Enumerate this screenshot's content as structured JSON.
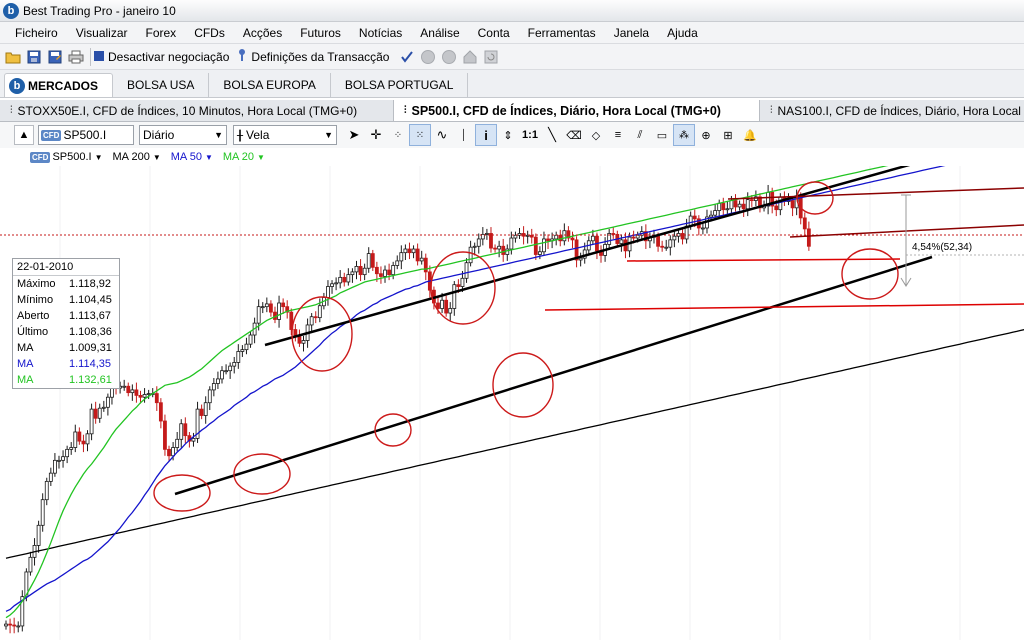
{
  "window": {
    "title": "Best Trading Pro - janeiro 10",
    "app_icon": "b"
  },
  "menu": [
    "Ficheiro",
    "Visualizar",
    "Forex",
    "CFDs",
    "Acções",
    "Futuros",
    "Notícias",
    "Análise",
    "Conta",
    "Ferramentas",
    "Janela",
    "Ajuda"
  ],
  "toolbar": {
    "deactivate_label": "Desactivar negociação",
    "definitions_label": "Definições da Transacção"
  },
  "market_tabs": {
    "brand": "MERCADOS",
    "items": [
      "BOLSA USA",
      "BOLSA EUROPA",
      "BOLSA PORTUGAL"
    ]
  },
  "chart_tabs": [
    {
      "label": "STOXX50E.I, CFD de Índices, 10 Minutos, Hora Local (TMG+0)",
      "active": false
    },
    {
      "label": "SP500.I, CFD de Índices, Diário, Hora Local (TMG+0)",
      "active": true
    },
    {
      "label": "NAS100.I, CFD de Índices, Diário, Hora Local (TMG+0)",
      "active": false
    }
  ],
  "chart_toolbar": {
    "symbol": "SP500.I",
    "symbol_badge": "CFD",
    "timeframe": "Diário",
    "chart_type": "Vela",
    "ratio_label": "1:1"
  },
  "legend": {
    "symbol": "SP500.I",
    "ma200": "MA 200",
    "ma50": "MA 50",
    "ma20": "MA 20",
    "colors": {
      "ma200": "#000000",
      "ma50": "#1414cc",
      "ma20": "#22c422"
    }
  },
  "info": {
    "date": "22-01-2010",
    "rows": [
      {
        "label": "Máximo",
        "value": "1.118,92",
        "color": "#000000"
      },
      {
        "label": "Mínimo",
        "value": "1.104,45",
        "color": "#000000"
      },
      {
        "label": "Aberto",
        "value": "1.113,67",
        "color": "#000000"
      },
      {
        "label": "Último",
        "value": "1.108,36",
        "color": "#000000"
      },
      {
        "label": "MA",
        "value": "1.009,31",
        "color": "#000000"
      },
      {
        "label": "MA",
        "value": "1.114,35",
        "color": "#1414cc"
      },
      {
        "label": "MA",
        "value": "1.132,61",
        "color": "#22c422"
      }
    ]
  },
  "annotation": {
    "measure_label": "4,54%(52,34)"
  },
  "chart_data": {
    "type": "candlestick",
    "x": [
      0,
      1,
      2,
      3,
      4,
      5,
      6,
      7,
      8,
      9,
      10,
      11,
      12,
      13,
      14,
      15,
      16,
      17,
      18,
      19,
      20,
      21,
      22,
      23,
      24,
      25,
      26,
      27,
      28,
      29,
      30,
      31,
      32,
      33,
      34,
      35,
      36,
      37,
      38,
      39,
      40,
      41,
      42,
      43,
      44,
      45,
      46,
      47,
      48,
      49,
      50,
      51,
      52,
      53,
      54,
      55,
      56,
      57,
      58,
      59,
      60,
      61,
      62,
      63,
      64,
      65,
      66,
      67,
      68,
      69,
      70,
      71,
      72,
      73,
      74,
      75,
      76,
      77,
      78,
      79,
      80,
      81,
      82,
      83,
      84,
      85,
      86,
      87,
      88,
      89,
      90,
      91,
      92,
      93,
      94,
      95,
      96,
      97,
      98,
      99,
      100,
      101,
      102,
      103,
      104,
      105,
      106,
      107,
      108,
      109,
      110,
      111,
      112,
      113,
      114,
      115,
      116,
      117,
      118,
      119,
      120,
      121,
      122,
      123,
      124,
      125,
      126,
      127,
      128,
      129,
      130,
      131,
      132,
      133,
      134,
      135,
      136,
      137,
      138,
      139,
      140,
      141,
      142,
      143,
      144,
      145,
      146,
      147,
      148,
      149,
      150,
      151,
      152,
      153,
      154,
      155,
      156,
      157,
      158,
      159,
      160,
      161,
      162,
      163,
      164,
      165,
      166,
      167,
      168,
      169,
      170,
      171,
      172,
      173,
      174,
      175,
      176,
      177,
      178,
      179,
      180,
      181,
      182,
      183,
      184,
      185,
      186,
      187,
      188,
      189,
      190,
      191,
      192,
      193,
      194,
      195,
      196,
      197,
      198,
      199,
      200,
      201,
      202,
      203,
      204,
      205,
      206,
      207,
      208,
      209,
      210,
      211,
      212
    ],
    "close": [
      683,
      682,
      681,
      681,
      713,
      740,
      756,
      769,
      791,
      819,
      839,
      848,
      862,
      862,
      866,
      874,
      876,
      893,
      883,
      880,
      891,
      918,
      908,
      919,
      920,
      931,
      945,
      941,
      943,
      943,
      936,
      939,
      933,
      931,
      934,
      935,
      935,
      925,
      905,
      874,
      867,
      876,
      885,
      902,
      889,
      883,
      886,
      918,
      911,
      925,
      939,
      946,
      951,
      960,
      960,
      965,
      969,
      981,
      983,
      989,
      999,
      1012,
      1030,
      1030,
      1033,
      1024,
      1016,
      1034,
      1030,
      1024,
      1005,
      997,
      990,
      993,
      1010,
      1019,
      1018,
      1031,
      1040,
      1052,
      1055,
      1056,
      1062,
      1057,
      1065,
      1068,
      1074,
      1065,
      1072,
      1088,
      1073,
      1066,
      1063,
      1070,
      1065,
      1075,
      1080,
      1089,
      1093,
      1089,
      1093,
      1080,
      1083,
      1068,
      1048,
      1034,
      1028,
      1037,
      1023,
      1028,
      1054,
      1052,
      1061,
      1078,
      1095,
      1096,
      1104,
      1109,
      1110,
      1094,
      1093,
      1096,
      1087,
      1093,
      1105,
      1108,
      1110,
      1107,
      1108,
      1106,
      1087,
      1090,
      1104,
      1102,
      1104,
      1108,
      1102,
      1113,
      1105,
      1103,
      1081,
      1083,
      1092,
      1102,
      1107,
      1091,
      1086,
      1098,
      1110,
      1109,
      1099,
      1103,
      1091,
      1106,
      1105,
      1108,
      1112,
      1102,
      1106,
      1107,
      1096,
      1095,
      1095,
      1103,
      1107,
      1110,
      1104,
      1118,
      1129,
      1126,
      1116,
      1116,
      1128,
      1130,
      1135,
      1143,
      1136,
      1137,
      1146,
      1139,
      1142,
      1137,
      1147,
      1146,
      1150,
      1138,
      1140,
      1155,
      1140,
      1136,
      1150,
      1145,
      1146,
      1138,
      1151,
      1127,
      1115,
      1096
    ],
    "ma200": [
      755,
      756,
      757,
      758,
      759,
      760,
      761,
      762,
      763,
      764,
      765,
      766,
      767,
      768,
      769,
      770,
      771,
      772,
      773,
      774,
      775,
      776,
      777,
      778,
      779,
      780,
      781,
      782,
      783,
      784,
      785,
      786,
      787,
      788,
      789,
      790,
      791,
      792,
      793,
      794,
      795,
      796,
      797,
      798,
      799,
      800,
      801,
      802,
      803,
      804,
      805,
      806,
      807,
      808,
      809,
      810,
      811,
      812,
      813,
      814,
      815,
      816,
      817,
      818,
      819,
      820,
      821,
      822,
      823,
      824,
      825,
      826,
      827,
      828,
      829,
      830,
      831,
      832,
      833,
      834,
      835,
      836,
      837,
      838,
      839,
      840,
      841,
      842,
      843,
      844,
      845,
      846,
      847,
      848,
      849,
      850,
      851,
      852,
      853,
      854,
      855,
      856,
      857,
      858,
      859,
      860,
      861,
      862,
      863,
      864,
      865,
      866,
      867,
      868,
      869,
      870,
      871,
      872,
      873,
      874,
      875,
      876,
      877,
      878,
      879,
      880,
      881,
      882,
      883,
      884,
      885,
      886,
      887,
      888,
      889,
      890,
      891,
      892,
      893,
      894,
      895,
      896,
      897,
      898,
      899,
      900,
      901,
      902,
      903,
      904,
      905,
      906,
      907,
      908,
      909,
      910,
      911,
      912,
      913,
      914,
      915,
      916,
      917,
      918,
      919,
      920,
      921,
      922,
      923,
      924,
      925,
      926,
      927,
      928,
      929,
      930,
      931,
      932,
      933,
      934,
      935,
      936,
      937,
      938,
      939,
      940,
      941,
      942,
      943,
      944,
      945,
      946,
      947,
      948,
      949,
      950,
      951,
      952,
      953,
      954,
      955,
      956,
      957,
      958,
      959,
      960,
      961,
      962,
      963,
      964,
      965,
      966,
      967,
      968,
      969,
      970,
      971,
      972,
      973,
      974,
      975,
      976,
      977,
      978,
      979,
      980,
      981,
      982,
      983,
      984,
      985,
      986,
      987,
      988,
      989,
      990,
      991,
      992,
      993,
      994,
      995,
      996,
      997,
      998,
      999,
      1000,
      1001,
      1002,
      1003,
      1004,
      1005,
      1006,
      1007,
      1008,
      1009
    ],
    "ma50": [
      697,
      699,
      703,
      706,
      709,
      712,
      715,
      718,
      721,
      724,
      727,
      729,
      731,
      734,
      737,
      740,
      743,
      746,
      749,
      752,
      754,
      757,
      761,
      765,
      769,
      773,
      778,
      783,
      788,
      794,
      800,
      805,
      811,
      817,
      824,
      830,
      837,
      844,
      850,
      856,
      861,
      866,
      871,
      875,
      880,
      884,
      888,
      891,
      895,
      898,
      902,
      905,
      909,
      912,
      915,
      918,
      922,
      925,
      928,
      931,
      935,
      937,
      940,
      943,
      945,
      948,
      951,
      953,
      955,
      958,
      961,
      964,
      968,
      972,
      976,
      980,
      984,
      988,
      993,
      997,
      1001,
      1004,
      1008,
      1011,
      1014,
      1017,
      1021,
      1024,
      1026,
      1029,
      1032,
      1034,
      1037,
      1039,
      1041,
      1043,
      1045,
      1047,
      1049,
      1050,
      1052,
      1053,
      1055,
      1057,
      1058,
      1059,
      1060,
      1061,
      1062,
      1063,
      1064,
      1065,
      1066,
      1067,
      1068,
      1069,
      1070,
      1071,
      1072,
      1073,
      1074,
      1075,
      1076,
      1077,
      1078,
      1079,
      1080,
      1081,
      1082,
      1083,
      1084,
      1085,
      1086,
      1087,
      1088,
      1089,
      1090,
      1091,
      1092,
      1093,
      1094,
      1095,
      1096,
      1097,
      1098,
      1099,
      1100,
      1101,
      1102,
      1103,
      1104,
      1105,
      1106,
      1107,
      1108,
      1109,
      1110,
      1111,
      1112,
      1113,
      1114,
      1115,
      1116,
      1117,
      1118,
      1119,
      1120,
      1121,
      1122,
      1123,
      1124,
      1125,
      1126,
      1127,
      1128,
      1129,
      1130,
      1131,
      1132,
      1133,
      1134,
      1135,
      1136,
      1137,
      1138,
      1139,
      1140,
      1141,
      1142,
      1143,
      1144,
      1145,
      1146,
      1147,
      1148,
      1149,
      1150,
      1151,
      1152,
      1153,
      1154,
      1155,
      1156,
      1157,
      1158,
      1159,
      1160,
      1161,
      1162,
      1163,
      1164,
      1165,
      1166,
      1167,
      1168,
      1169,
      1170,
      1171,
      1172,
      1173,
      1174,
      1175,
      1176,
      1177,
      1178,
      1179,
      1180,
      1181,
      1182,
      1183,
      1184,
      1185,
      1186,
      1187,
      1188
    ],
    "ma20": [
      690,
      693,
      697,
      702,
      708,
      715,
      723,
      731,
      740,
      750,
      761,
      772,
      784,
      796,
      807,
      816,
      825,
      833,
      840,
      847,
      853,
      858,
      864,
      870,
      876,
      883,
      890,
      896,
      901,
      906,
      911,
      916,
      920,
      925,
      929,
      932,
      935,
      938,
      941,
      944,
      945,
      946,
      947,
      949,
      951,
      953,
      956,
      959,
      962,
      966,
      970,
      974,
      978,
      982,
      985,
      988,
      991,
      994,
      997,
      1000,
      1003,
      1006,
      1009,
      1012,
      1015,
      1017,
      1019,
      1021,
      1023,
      1025,
      1026,
      1027,
      1028,
      1029,
      1030,
      1031,
      1032,
      1034,
      1036,
      1038,
      1040,
      1042,
      1045,
      1047,
      1049,
      1051,
      1053,
      1055,
      1057,
      1058,
      1059,
      1060,
      1061,
      1062,
      1063,
      1064,
      1065,
      1066,
      1067,
      1068,
      1069,
      1070,
      1071,
      1071,
      1072,
      1073,
      1074,
      1075,
      1076,
      1077,
      1078,
      1079,
      1080,
      1081,
      1082,
      1083,
      1084,
      1085,
      1086,
      1087,
      1088,
      1089,
      1090,
      1091,
      1092,
      1093,
      1094,
      1095,
      1096,
      1097,
      1098,
      1099,
      1100,
      1101,
      1102,
      1103,
      1104,
      1105,
      1106,
      1107,
      1108,
      1109,
      1110,
      1111,
      1112,
      1113,
      1114,
      1115,
      1116,
      1117,
      1118,
      1119,
      1120,
      1121,
      1122,
      1123,
      1124,
      1125,
      1126,
      1127,
      1128,
      1129,
      1130,
      1131,
      1132,
      1133,
      1134,
      1135,
      1136,
      1137,
      1138,
      1139,
      1140,
      1141,
      1142,
      1143,
      1144,
      1145,
      1146,
      1147,
      1148,
      1149,
      1150,
      1151,
      1152,
      1153,
      1154,
      1155,
      1156,
      1157,
      1158,
      1159,
      1160,
      1161,
      1162,
      1163,
      1164,
      1165,
      1166,
      1167,
      1168,
      1169,
      1170,
      1171,
      1172,
      1173,
      1174,
      1175,
      1176,
      1177,
      1178,
      1179,
      1180,
      1181,
      1182,
      1183,
      1184,
      1185,
      1186,
      1187,
      1188,
      1189,
      1190,
      1191,
      1192,
      1193,
      1194,
      1195,
      1196,
      1197,
      1198,
      1199,
      1200,
      1201,
      1202
    ],
    "ylim": [
      670,
      1175
    ],
    "bull_color": "#1a1a1a",
    "bear_color": "#c41a1a",
    "price_line": 1108.36
  }
}
